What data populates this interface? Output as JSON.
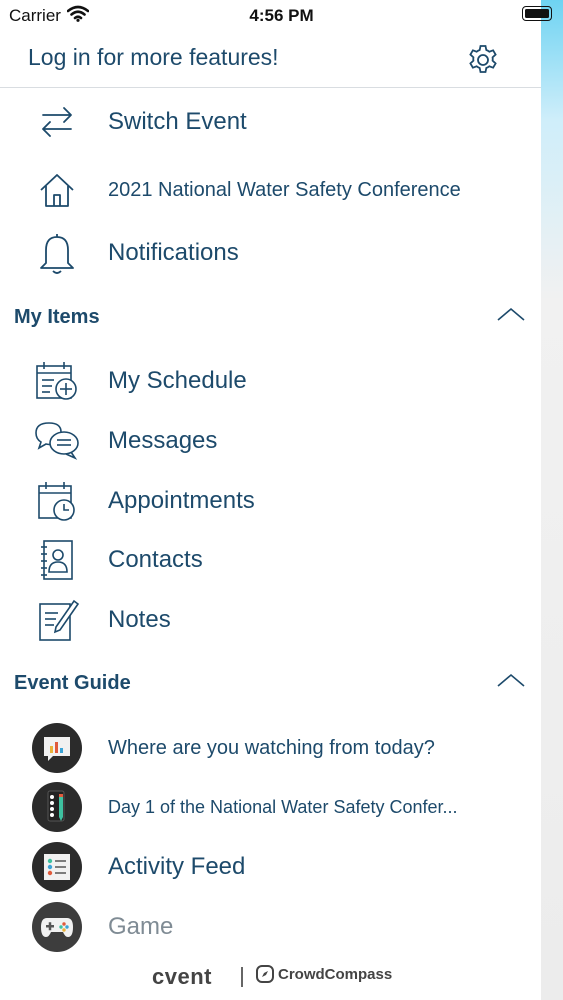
{
  "status_bar": {
    "carrier": "Carrier",
    "time": "4:56 PM"
  },
  "header": {
    "login_text": "Log in for more features!"
  },
  "top_items": [
    {
      "label": "Switch Event",
      "icon": "switch-arrows-icon"
    },
    {
      "label": "2021 National Water Safety Conference",
      "icon": "home-icon"
    },
    {
      "label": "Notifications",
      "icon": "bell-icon"
    }
  ],
  "my_items": {
    "title": "My Items",
    "items": [
      {
        "label": "My Schedule",
        "icon": "calendar-add-icon"
      },
      {
        "label": "Messages",
        "icon": "chat-bubbles-icon"
      },
      {
        "label": "Appointments",
        "icon": "calendar-clock-icon"
      },
      {
        "label": "Contacts",
        "icon": "address-book-icon"
      },
      {
        "label": "Notes",
        "icon": "note-pencil-icon"
      }
    ]
  },
  "event_guide": {
    "title": "Event Guide",
    "items": [
      {
        "label": "Where are you watching from today?",
        "icon": "poll-icon"
      },
      {
        "label": "Day 1 of the National Water Safety Confer...",
        "icon": "agenda-icon"
      },
      {
        "label": "Activity Feed",
        "icon": "activity-feed-icon"
      },
      {
        "label": "Game",
        "icon": "game-controller-icon"
      }
    ]
  },
  "footer": {
    "brand": "cvent",
    "partner": "CrowdCompass"
  },
  "colors": {
    "text": "#1d4a6b",
    "muted": "#7f8b94",
    "accent_strip": "#6ed3f2"
  }
}
